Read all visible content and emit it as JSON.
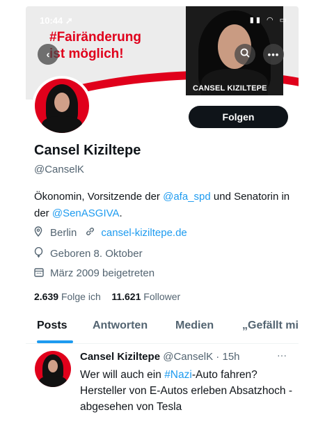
{
  "status_bar": {
    "time": "10:44 ➚",
    "icons": "▮▮ ◠ ▭"
  },
  "banner": {
    "slogan_line1": "#Fairänderung",
    "slogan_line2": "ist möglich!",
    "caption": "CANSEL KIZILTEPE",
    "colors": {
      "red": "#e0001b",
      "bg": "#ececec"
    }
  },
  "nav": {
    "back_icon": "back-arrow-icon",
    "search_icon": "search-icon",
    "more_icon": "more-icon"
  },
  "profile": {
    "follow_label": "Folgen",
    "name": "Cansel Kiziltepe",
    "handle": "@CanselK",
    "bio_part1": "Ökonomin, Vorsitzende der ",
    "bio_link1": "@afa_spd",
    "bio_part2": " und Senatorin in der ",
    "bio_link2": "@SenASGIVA",
    "bio_part3": ".",
    "location": "Berlin",
    "website": "cansel-kiziltepe.de",
    "birthday": "Geboren 8. Oktober",
    "joined": "März 2009 beigetreten",
    "following_count": "2.639",
    "following_label": "Folge ich",
    "followers_count": "11.621",
    "followers_label": "Follower"
  },
  "tabs": [
    {
      "label": "Posts",
      "active": true
    },
    {
      "label": "Antworten",
      "active": false
    },
    {
      "label": "Medien",
      "active": false
    },
    {
      "label": "„Gefällt mir“",
      "active": false
    }
  ],
  "post": {
    "author": "Cansel Kiziltepe",
    "handle_time": "@CanselK · 15h",
    "text_part1": "Wer will auch ein ",
    "hashtag": "#Nazi",
    "text_part2": "-Auto fahren?",
    "text_line2": "Hersteller von E-Autos erleben Absatzhoch - abgesehen von Tesla"
  },
  "colors": {
    "accent": "#1d9bf0",
    "text": "#0f1419",
    "muted": "#536471"
  }
}
